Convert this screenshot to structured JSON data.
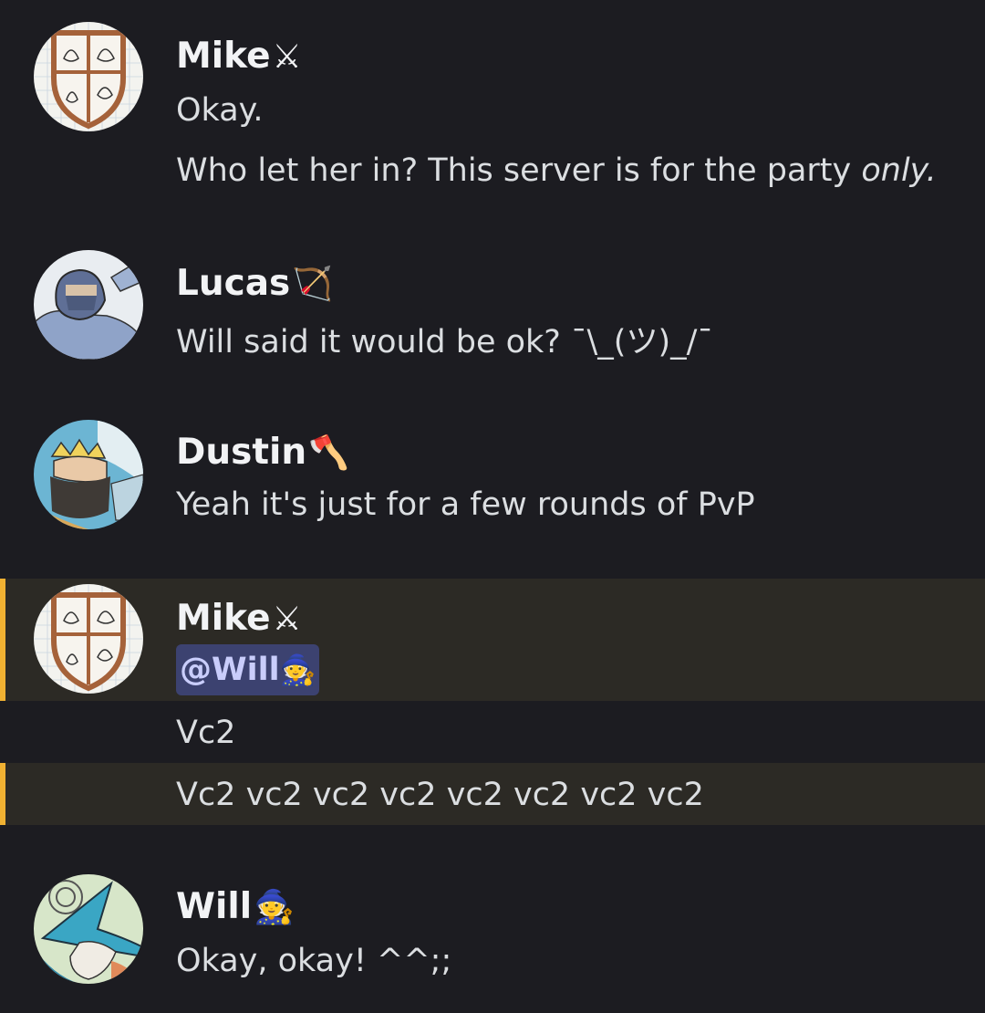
{
  "messages": [
    {
      "author": "Mike",
      "author_emoji": "⚔",
      "avatar_icon": "shield-leaves-avatar",
      "lines": [
        "Okay.",
        "Who let her in? This server is for the party "
      ],
      "emphasis": "only."
    },
    {
      "author": "Lucas",
      "author_emoji": "🏹",
      "avatar_icon": "hooded-figure-avatar",
      "lines": [
        "Will said it would be ok? ¯\\_(ツ)_/¯"
      ]
    },
    {
      "author": "Dustin",
      "author_emoji": "🪓",
      "avatar_icon": "crowned-dwarf-avatar",
      "lines": [
        "Yeah it's just for a few rounds of PvP"
      ]
    },
    {
      "author": "Mike",
      "author_emoji": "⚔",
      "avatar_icon": "shield-leaves-avatar",
      "mention": "@Will",
      "mention_emoji": "🧙",
      "lines": [
        "Vc2",
        "Vc2 vc2 vc2 vc2 vc2 vc2 vc2 vc2"
      ]
    },
    {
      "author": "Will",
      "author_emoji": "🧙",
      "avatar_icon": "wizard-hat-avatar",
      "lines": [
        "Okay, okay! ^^;;"
      ]
    }
  ],
  "colors": {
    "background": "#1c1c21",
    "highlight": "#2c2a25",
    "highlight_bar": "#f0b132",
    "mention_bg": "#3c4270"
  }
}
